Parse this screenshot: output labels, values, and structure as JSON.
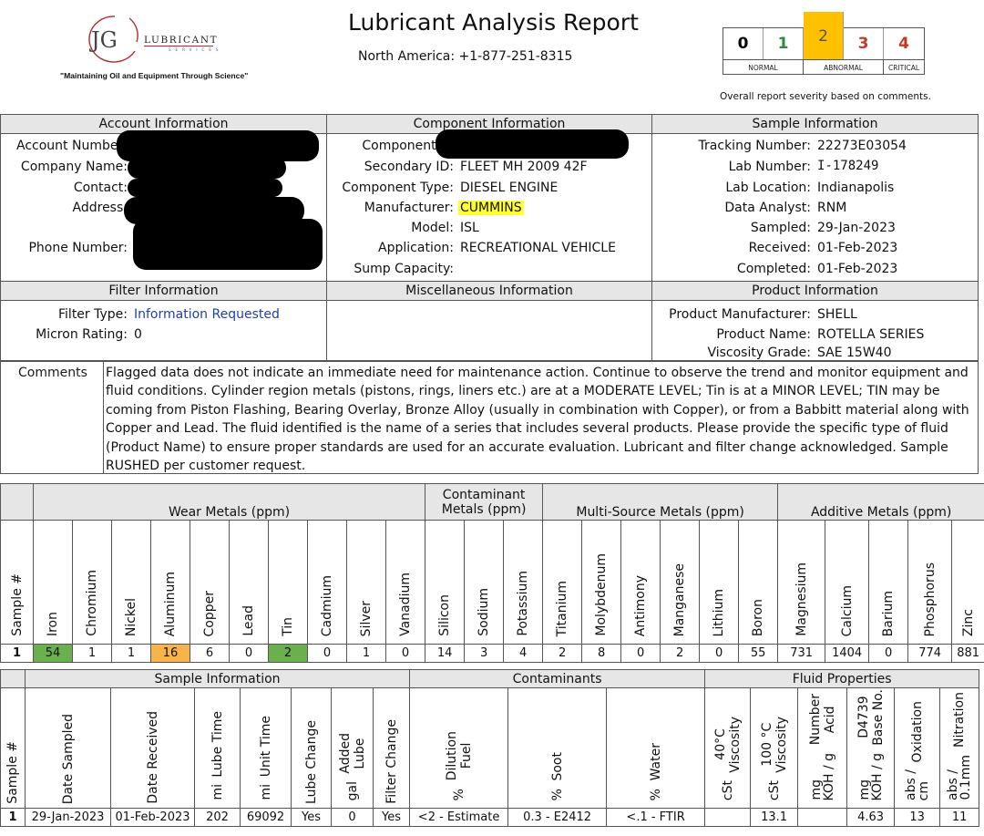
{
  "header": {
    "logo_initials": "JG",
    "logo_name": "LUBRICANT",
    "logo_sub": "SERVICES",
    "tagline": "\"Maintaining Oil and Equipment Through Science\"",
    "title": "Lubricant Analysis Report",
    "phone": "North America:  +1-877-251-8315"
  },
  "severity": {
    "levels": [
      {
        "value": "0",
        "color": "#000000"
      },
      {
        "value": "1",
        "color": "#2e8b3a"
      },
      {
        "value": "2",
        "color": "#555555"
      },
      {
        "value": "3",
        "color": "#c0392b"
      },
      {
        "value": "4",
        "color": "#c0392b"
      }
    ],
    "current": "2",
    "current_bg": "#ffc000",
    "labels": {
      "normal": "NORMAL",
      "abnormal": "ABNORMAL",
      "critical": "CRITICAL"
    },
    "note": "Overall report severity based on comments."
  },
  "account": {
    "header": "Account Information",
    "account_number_label": "Account Numbe",
    "company_label": "Company Name:",
    "contact_label": "Contact:",
    "address_label": "Address:",
    "phone_label": "Phone Number:"
  },
  "component": {
    "header": "Component Information",
    "rows": [
      {
        "label": "Component ID",
        "value": ""
      },
      {
        "label": "Secondary ID:",
        "value": "FLEET MH 2009 42F"
      },
      {
        "label": "Component Type:",
        "value": "DIESEL ENGINE"
      },
      {
        "label": "Manufacturer:",
        "value": "CUMMINS"
      },
      {
        "label": "Model:",
        "value": "ISL"
      },
      {
        "label": "Application:",
        "value": "RECREATIONAL VEHICLE"
      },
      {
        "label": "Sump Capacity:",
        "value": ""
      }
    ]
  },
  "sample": {
    "header": "Sample Information",
    "rows": [
      {
        "label": "Tracking Number:",
        "value": "22273E03054"
      },
      {
        "label": "Lab Number:",
        "value": "I-178249"
      },
      {
        "label": "Lab Location:",
        "value": "Indianapolis"
      },
      {
        "label": "Data Analyst:",
        "value": "RNM"
      },
      {
        "label": "Sampled:",
        "value": "29-Jan-2023"
      },
      {
        "label": "Received:",
        "value": "01-Feb-2023"
      },
      {
        "label": "Completed:",
        "value": "01-Feb-2023"
      }
    ]
  },
  "filter": {
    "header": "Filter Information",
    "type_label": "Filter Type:",
    "type_value": "Information Requested",
    "micron_label": "Micron Rating:",
    "micron_value": "0"
  },
  "misc": {
    "header": "Miscellaneous Information"
  },
  "product": {
    "header": "Product Information",
    "rows": [
      {
        "label": "Product Manufacturer:",
        "value": "SHELL"
      },
      {
        "label": "Product Name:",
        "value": "ROTELLA SERIES"
      },
      {
        "label": "Viscosity Grade:",
        "value": "SAE 15W40"
      }
    ]
  },
  "comments": {
    "label": "Comments",
    "lines": [
      "Flagged data does not indicate an immediate need for maintenance action. Continue to observe the trend and monitor equipment and",
      "fluid conditions. Cylinder region metals (pistons, rings, liners etc.) are at a MODERATE LEVEL; Tin is at a MINOR LEVEL; TIN may be",
      "coming from Piston Flashing, Bearing Overlay, Bronze Alloy (usually in combination with Copper), or from a Babbitt material along with",
      "Copper and Lead. The fluid identified is the name of a series that includes several products. Please provide the specific type of fluid",
      "(Product Name) to ensure proper standards are used for an accurate evaluation. Lubricant and filter change acknowledged. Sample",
      "RUSHED per customer request."
    ]
  },
  "metals": {
    "groups": {
      "wear": "Wear Metals (ppm)",
      "contam_line1": "Contaminant",
      "contam_line2": "Metals (ppm)",
      "multi": "Multi-Source Metals (ppm)",
      "additive": "Additive Metals (ppm)"
    },
    "sample_col": "Sample #",
    "columns": [
      "Iron",
      "Chromium",
      "Nickel",
      "Aluminum",
      "Copper",
      "Lead",
      "Tin",
      "Cadmium",
      "Silver",
      "Vanadium",
      "Silicon",
      "Sodium",
      "Potassium",
      "Titanium",
      "Molybdenum",
      "Antimony",
      "Manganese",
      "Lithium",
      "Boron",
      "Magnesium",
      "Calcium",
      "Barium",
      "Phosphorus",
      "Zinc"
    ],
    "row": {
      "sample": "1",
      "values": [
        "54",
        "1",
        "1",
        "16",
        "6",
        "0",
        "2",
        "0",
        "1",
        "0",
        "14",
        "3",
        "4",
        "2",
        "8",
        "0",
        "2",
        "0",
        "55",
        "731",
        "1404",
        "0",
        "774",
        "881"
      ]
    },
    "flags": {
      "Iron": "#6ab04c",
      "Aluminum": "#f7b44a",
      "Tin": "#6ab04c"
    }
  },
  "fluid_table": {
    "groups": {
      "sample": "Sample Information",
      "contaminants": "Contaminants",
      "fluid": "Fluid Properties"
    },
    "columns": [
      {
        "name": "Sample #",
        "unit": ""
      },
      {
        "name": "Date Sampled",
        "unit": ""
      },
      {
        "name": "Date  Received",
        "unit": ""
      },
      {
        "name": "Lube Time",
        "unit": "mi"
      },
      {
        "name": "Unit Time",
        "unit": "mi"
      },
      {
        "name": "Lube Change",
        "unit": ""
      },
      {
        "name": "Lube|Added",
        "unit": "gal"
      },
      {
        "name": "Filter Change",
        "unit": ""
      },
      {
        "name": "Fuel|Dilution",
        "unit": "%"
      },
      {
        "name": "Soot",
        "unit": "%"
      },
      {
        "name": "Water",
        "unit": "%"
      },
      {
        "name": "Viscosity|40°C",
        "unit": "cSt"
      },
      {
        "name": "Viscosity|100 °C",
        "unit": "cSt"
      },
      {
        "name": "Acid|Number",
        "unit": "mg|KOH / g"
      },
      {
        "name": "Base No.|D4739",
        "unit": "mg|KOH / g"
      },
      {
        "name": "Oxidation",
        "unit": "abs /|cm"
      },
      {
        "name": "Nitration",
        "unit": "abs /|0.1mm"
      }
    ],
    "row": [
      "1",
      "29-Jan-2023",
      "01-Feb-2023",
      "202",
      "69092",
      "Yes",
      "0",
      "Yes",
      "<2 - Estimate",
      "0.3 - E2412",
      "<.1 - FTIR",
      "",
      "13.1",
      "",
      "4.63",
      "13",
      "11"
    ]
  }
}
